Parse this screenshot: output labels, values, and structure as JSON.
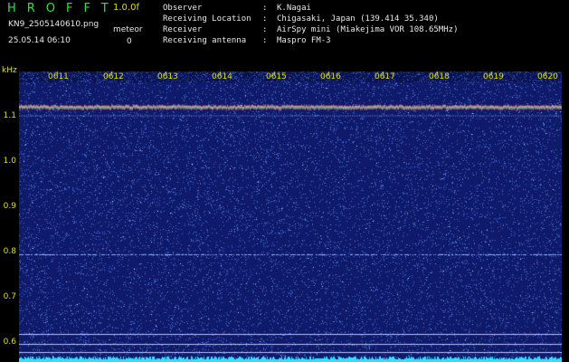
{
  "header": {
    "title": "HROFFT",
    "version": "1.0.0f",
    "filename": "KN9_2505140610.png",
    "datetime": "25.05.14 06:10",
    "meteor_label": "meteor",
    "meteor_count": "0",
    "info": [
      {
        "key": "Observer",
        "value": "K.Nagai"
      },
      {
        "key": "Receiving Location",
        "value": "Chigasaki, Japan (139.414 35.340)"
      },
      {
        "key": "Receiver",
        "value": "AirSpy mini (Miakejima VOR 108.65MHz)"
      },
      {
        "key": "Receiving antenna",
        "value": "Maspro FM-3"
      }
    ]
  },
  "spectrogram": {
    "y_unit": "kHz",
    "y_ticks": [
      "1.1",
      "1.0",
      "0.9",
      "0.8",
      "0.7",
      "0.6"
    ],
    "x_ticks": [
      "0611",
      "0612",
      "0613",
      "0614",
      "0615",
      "0616",
      "0617",
      "0618",
      "0619",
      "0620"
    ],
    "background_color": "#101a6a",
    "noise_color": "#3e6ad8",
    "carrier_khz": 1.115,
    "faint_line_khz": 0.79
  }
}
